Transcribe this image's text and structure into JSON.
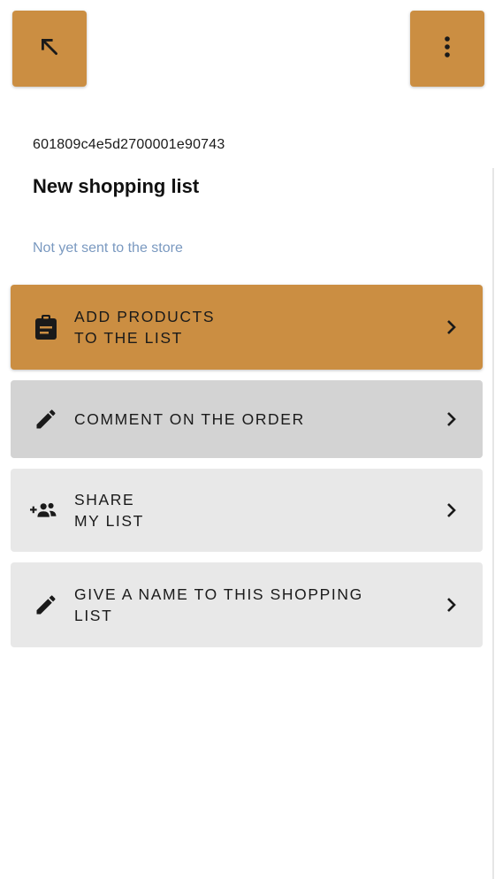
{
  "header": {
    "back_icon": "arrow-up-left-icon",
    "menu_icon": "vertical-dots-icon"
  },
  "list": {
    "id": "601809c4e5d2700001e90743",
    "title": "New shopping list",
    "status": "Not yet sent to the store"
  },
  "actions": [
    {
      "label_line1": "ADD PRODUCTS",
      "label_line2": "TO THE LIST",
      "icon": "clipboard-icon"
    },
    {
      "label_line1": "COMMENT ON THE ORDER",
      "label_line2": "",
      "icon": "pencil-icon"
    },
    {
      "label_line1": "SHARE",
      "label_line2": "MY LIST",
      "icon": "add-group-icon"
    },
    {
      "label_line1": "GIVE A NAME TO THIS SHOPPING",
      "label_line2": "LIST",
      "icon": "pencil-icon"
    }
  ],
  "colors": {
    "accent": "#cb8e42",
    "status_text": "#7a99c0",
    "button_grey": "#e8e8e8",
    "button_grey_active": "#d3d3d3"
  }
}
